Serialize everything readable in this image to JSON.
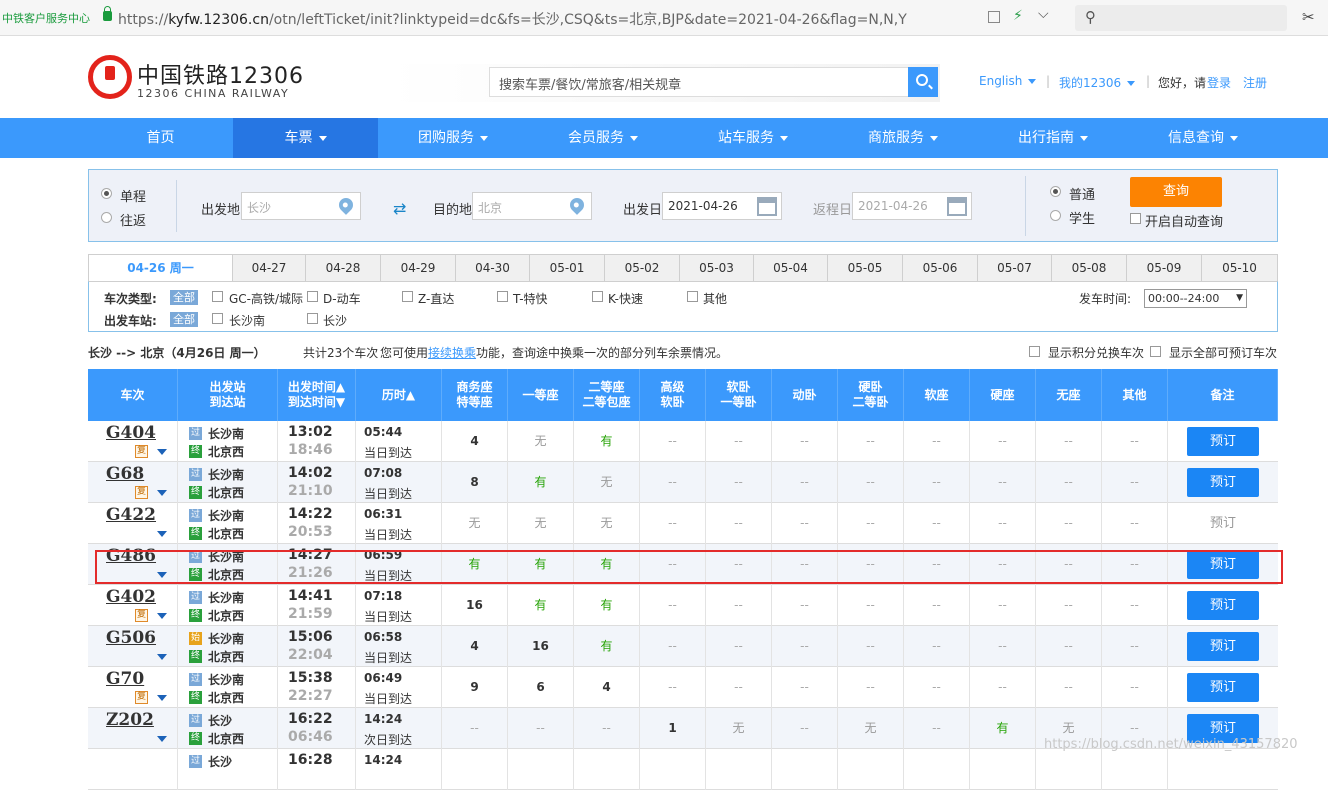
{
  "browser": {
    "site_label": "中铁客户服务中心",
    "url_prefix": "https://",
    "url_host": "kyfw.12306.cn",
    "url_path": "/otn/leftTicket/init?linktypeid=dc&fs=长沙,CSQ&ts=北京,BJP&date=2021-04-26&flag=N,N,Y"
  },
  "header": {
    "logo_name": "中国铁路12306",
    "logo_sub": "12306 CHINA RAILWAY",
    "search_placeholder": "搜索车票/餐饮/常旅客/相关规章",
    "lang": "English",
    "my12306": "我的12306",
    "greeting": "您好，请",
    "login": "登录",
    "register": "注册"
  },
  "nav": [
    "首页",
    "车票",
    "团购服务",
    "会员服务",
    "站车服务",
    "商旅服务",
    "出行指南",
    "信息查询"
  ],
  "query": {
    "one_way": "单程",
    "round_trip": "往返",
    "from_label": "出发地",
    "from_value": "长沙",
    "to_label": "目的地",
    "to_value": "北京",
    "date_label": "出发日",
    "date_value": "2021-04-26",
    "return_label": "返程日",
    "return_value": "2021-04-26",
    "normal": "普通",
    "student": "学生",
    "query_button": "查询",
    "auto_query": "开启自动查询"
  },
  "date_tabs": [
    "04-26 周一",
    "04-27",
    "04-28",
    "04-29",
    "04-30",
    "05-01",
    "05-02",
    "05-03",
    "05-04",
    "05-05",
    "05-06",
    "05-07",
    "05-08",
    "05-09",
    "05-10"
  ],
  "filters": {
    "type_label": "车次类型:",
    "station_label": "出发车站:",
    "all_tag": "全部",
    "types": [
      "GC-高铁/城际",
      "D-动车",
      "Z-直达",
      "T-特快",
      "K-快速",
      "其他"
    ],
    "stations": [
      "长沙南",
      "长沙"
    ],
    "time_label": "发车时间:",
    "time_value": "00:00--24:00"
  },
  "summary": {
    "route": "长沙 --> 北京（4月26日  周一）",
    "count": "共计23个车次",
    "tip_pre": "您可使用",
    "tip_link": "接续换乘",
    "tip_post": "功能，查询途中换乘一次的部分列车余票情况。",
    "opt1": "显示积分兑换车次",
    "opt2": "显示全部可预订车次"
  },
  "table": {
    "headers": [
      "车次",
      "出发站\n到达站",
      "出发时间▲\n到达时间▼",
      "历时▲",
      "商务座\n特等座",
      "一等座",
      "二等座\n二等包座",
      "高级\n软卧",
      "软卧\n一等卧",
      "动卧",
      "硬卧\n二等卧",
      "软座",
      "硬座",
      "无座",
      "其他",
      "备注"
    ],
    "rows": [
      {
        "train": "G404",
        "fu": true,
        "from_icon": "过",
        "from": "长沙南",
        "to_icon": "终",
        "to": "北京西",
        "dep": "13:02",
        "arr": "18:46",
        "dur": "05:44",
        "day": "当日到达",
        "seats": [
          "4",
          "无",
          "有",
          "--",
          "--",
          "--",
          "--",
          "--",
          "--",
          "--",
          "--"
        ],
        "note": "预订",
        "bookable": true
      },
      {
        "train": "G68",
        "fu": true,
        "from_icon": "过",
        "from": "长沙南",
        "to_icon": "终",
        "to": "北京西",
        "dep": "14:02",
        "arr": "21:10",
        "dur": "07:08",
        "day": "当日到达",
        "seats": [
          "8",
          "有",
          "无",
          "--",
          "--",
          "--",
          "--",
          "--",
          "--",
          "--",
          "--"
        ],
        "note": "预订",
        "bookable": true
      },
      {
        "train": "G422",
        "fu": false,
        "from_icon": "过",
        "from": "长沙南",
        "to_icon": "终",
        "to": "北京西",
        "dep": "14:22",
        "arr": "20:53",
        "dur": "06:31",
        "day": "当日到达",
        "seats": [
          "无",
          "无",
          "无",
          "--",
          "--",
          "--",
          "--",
          "--",
          "--",
          "--",
          "--"
        ],
        "note": "预订",
        "bookable": false
      },
      {
        "train": "G486",
        "fu": false,
        "from_icon": "过",
        "from": "长沙南",
        "to_icon": "终",
        "to": "北京西",
        "dep": "14:27",
        "arr": "21:26",
        "dur": "06:59",
        "day": "当日到达",
        "seats": [
          "有",
          "有",
          "有",
          "--",
          "--",
          "--",
          "--",
          "--",
          "--",
          "--",
          "--"
        ],
        "note": "预订",
        "bookable": true
      },
      {
        "train": "G402",
        "fu": true,
        "from_icon": "过",
        "from": "长沙南",
        "to_icon": "终",
        "to": "北京西",
        "dep": "14:41",
        "arr": "21:59",
        "dur": "07:18",
        "day": "当日到达",
        "seats": [
          "16",
          "有",
          "有",
          "--",
          "--",
          "--",
          "--",
          "--",
          "--",
          "--",
          "--"
        ],
        "note": "预订",
        "bookable": true
      },
      {
        "train": "G506",
        "fu": false,
        "from_icon": "始",
        "from": "长沙南",
        "to_icon": "终",
        "to": "北京西",
        "dep": "15:06",
        "arr": "22:04",
        "dur": "06:58",
        "day": "当日到达",
        "seats": [
          "4",
          "16",
          "有",
          "--",
          "--",
          "--",
          "--",
          "--",
          "--",
          "--",
          "--"
        ],
        "note": "预订",
        "bookable": true
      },
      {
        "train": "G70",
        "fu": true,
        "from_icon": "过",
        "from": "长沙南",
        "to_icon": "终",
        "to": "北京西",
        "dep": "15:38",
        "arr": "22:27",
        "dur": "06:49",
        "day": "当日到达",
        "seats": [
          "9",
          "6",
          "4",
          "--",
          "--",
          "--",
          "--",
          "--",
          "--",
          "--",
          "--"
        ],
        "note": "预订",
        "bookable": true
      },
      {
        "train": "Z202",
        "fu": false,
        "from_icon": "过",
        "from": "长沙",
        "to_icon": "终",
        "to": "北京西",
        "dep": "16:22",
        "arr": "06:46",
        "dur": "14:24",
        "day": "次日到达",
        "seats": [
          "--",
          "--",
          "--",
          "1",
          "无",
          "--",
          "无",
          "--",
          "有",
          "无",
          "--"
        ],
        "note": "预订",
        "bookable": true
      },
      {
        "train": "",
        "fu": false,
        "from_icon": "过",
        "from": "长沙",
        "to_icon": "",
        "to": "",
        "dep": "16:28",
        "arr": "",
        "dur": "14:24",
        "day": "",
        "seats": [
          "",
          "",
          "",
          "",
          "",
          "",
          "",
          "",
          "",
          "",
          ""
        ],
        "note": "",
        "bookable": true
      }
    ]
  },
  "watermark": "https://blog.csdn.net/weixin_43157820",
  "colors": {
    "primary": "#3b99fc",
    "accent": "#fc8302",
    "available": "#26a306",
    "highlight": "#e32b2b"
  }
}
